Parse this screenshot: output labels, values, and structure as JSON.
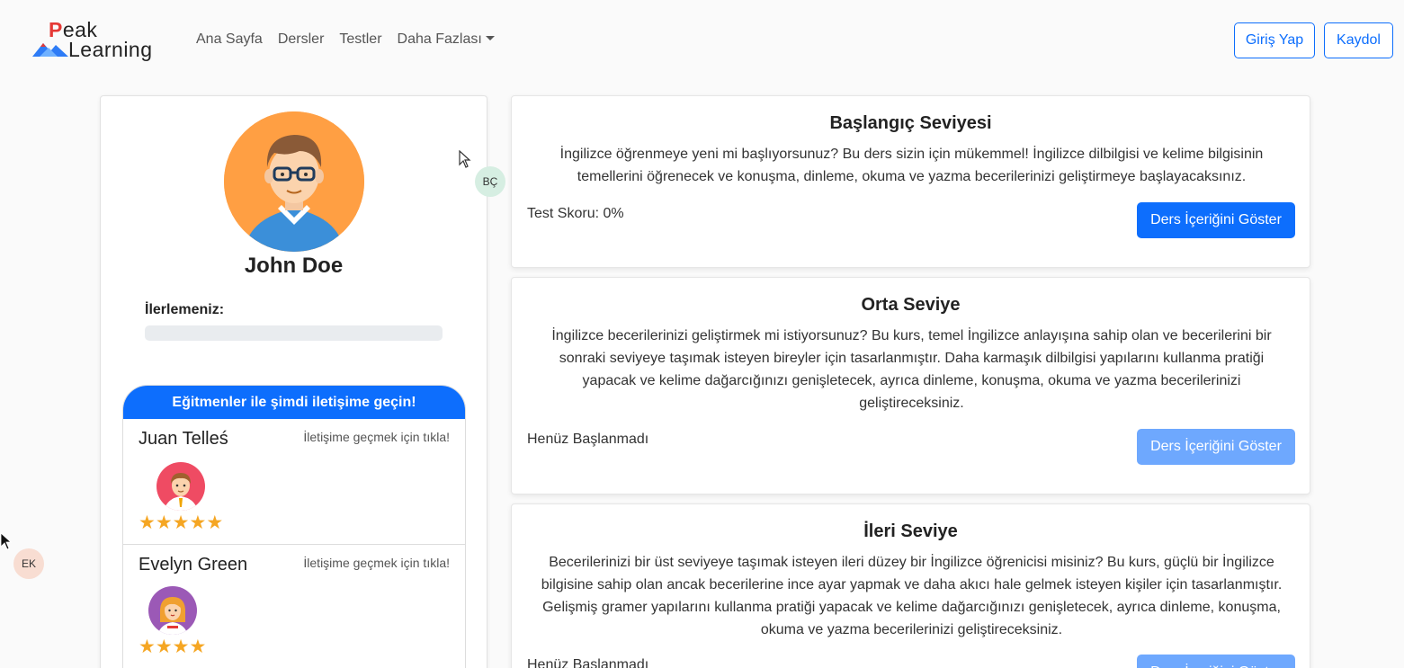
{
  "brand": {
    "line1_first": "P",
    "line1_rest": "eak",
    "line2": "Learning"
  },
  "nav": {
    "items": [
      {
        "label": "Ana Sayfa"
      },
      {
        "label": "Dersler"
      },
      {
        "label": "Testler"
      },
      {
        "label": "Daha Fazlası"
      }
    ],
    "login_label": "Giriş Yap",
    "register_label": "Kaydol"
  },
  "profile": {
    "name": "John Doe",
    "progress_label": "İlerlemeniz:",
    "progress_fraction": 0
  },
  "contact": {
    "header": "Eğitmenler ile şimdi iletişime geçin!",
    "instructors": [
      {
        "name": "Juan Telleś",
        "link": "İletişime geçmek için tıkla!",
        "rating": 5
      },
      {
        "name": "Evelyn Green",
        "link": "İletişime geçmek için tıkla!",
        "rating": 4
      }
    ]
  },
  "levels": [
    {
      "title": "Başlangıç Seviyesi",
      "description": "İngilizce öğrenmeye yeni mi başlıyorsunuz? Bu ders sizin için mükemmel! İngilizce dilbilgisi ve kelime bilgisinin temellerini öğrenecek ve konuşma, dinleme, okuma ve yazma becerilerinizi geliştirmeye başlayacaksınız.",
      "status": "Test Skoru: 0%",
      "button": "Ders İçeriğini Göster"
    },
    {
      "title": "Orta Seviye",
      "description": "İngilizce becerilerinizi geliştirmek mi istiyorsunuz? Bu kurs, temel İngilizce anlayışına sahip olan ve becerilerini bir sonraki seviyeye taşımak isteyen bireyler için tasarlanmıştır. Daha karmaşık dilbilgisi yapılarını kullanma pratiği yapacak ve kelime dağarcığınızı genişletecek, ayrıca dinleme, konuşma, okuma ve yazma becerilerinizi geliştireceksiniz.",
      "status": "Henüz Başlanmadı",
      "button": "Ders İçeriğini Göster"
    },
    {
      "title": "İleri Seviye",
      "description": "Becerilerinizi bir üst seviyeye taşımak isteyen ileri düzey bir İngilizce öğrenicisi misiniz? Bu kurs, güçlü bir İngilizce bilgisine sahip olan ancak becerilerine ince ayar yapmak ve daha akıcı hale gelmek isteyen kişiler için tasarlanmıştır. Gelişmiş gramer yapılarını kullanma pratiği yapacak ve kelime dağarcığınızı genişletecek, ayrıca dinleme, konuşma, okuma ve yazma becerilerinizi geliştireceksiniz.",
      "status": "Henüz Başlanmadı",
      "button": "Ders İçeriğini Göster"
    }
  ],
  "badges": {
    "top": "BÇ",
    "bottom": "EK"
  },
  "colors": {
    "primary": "#0d6efd",
    "primary_disabled": "#6ea8fe",
    "star": "#f5a623",
    "avatar_bg": "#ff9f43"
  }
}
